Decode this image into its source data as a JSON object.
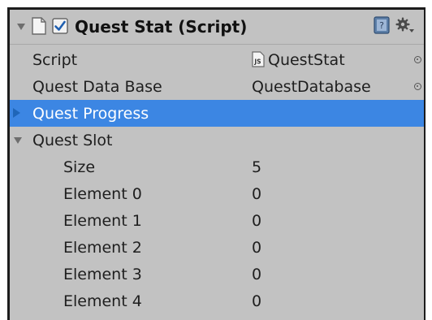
{
  "header": {
    "title": "Quest Stat (Script)",
    "enabled": true,
    "book_icon": "reference-book-icon",
    "gear_icon": "gear-icon"
  },
  "fields": {
    "script": {
      "label": "Script",
      "value": "QuestStat",
      "value_icon": "js-file-icon"
    },
    "quest_data_base": {
      "label": "Quest Data Base",
      "value": "QuestDatabase"
    },
    "quest_progress": {
      "label": "Quest Progress",
      "expanded": false
    },
    "quest_slot": {
      "label": "Quest Slot",
      "expanded": true,
      "size": {
        "label": "Size",
        "value": "5"
      },
      "elements": [
        {
          "label": "Element 0",
          "value": "0"
        },
        {
          "label": "Element 1",
          "value": "0"
        },
        {
          "label": "Element 2",
          "value": "0"
        },
        {
          "label": "Element 3",
          "value": "0"
        },
        {
          "label": "Element 4",
          "value": "0"
        }
      ]
    }
  },
  "colors": {
    "panel_bg": "#c2c2c2",
    "selection": "#3c86e3",
    "checkbox_check": "#1f5fb0"
  }
}
